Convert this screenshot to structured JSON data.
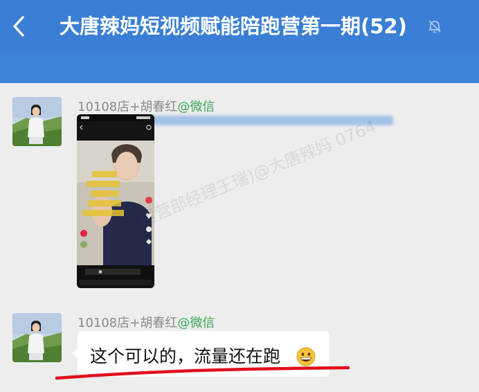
{
  "header": {
    "back_icon": "chevron-left-icon",
    "title": "大唐辣妈短视频赋能陪跑营第一期(52)",
    "mute_icon": "bell-off-icon",
    "background_color": "#3a7fd5"
  },
  "messages": [
    {
      "sender_name": "10108店+胡春红",
      "sender_source": "@微信",
      "type": "video"
    },
    {
      "sender_name": "10108店+胡春红",
      "sender_source": "@微信",
      "type": "text",
      "text": "这个可以的，流量还在跑",
      "emoji_icon": "grinning-face-icon"
    }
  ],
  "watermark": "运营部经理王瑞)@大唐辣妈 0764",
  "colors": {
    "source_green": "#3aa85a",
    "underline_red": "#e0101c",
    "chat_background": "#ededed"
  }
}
